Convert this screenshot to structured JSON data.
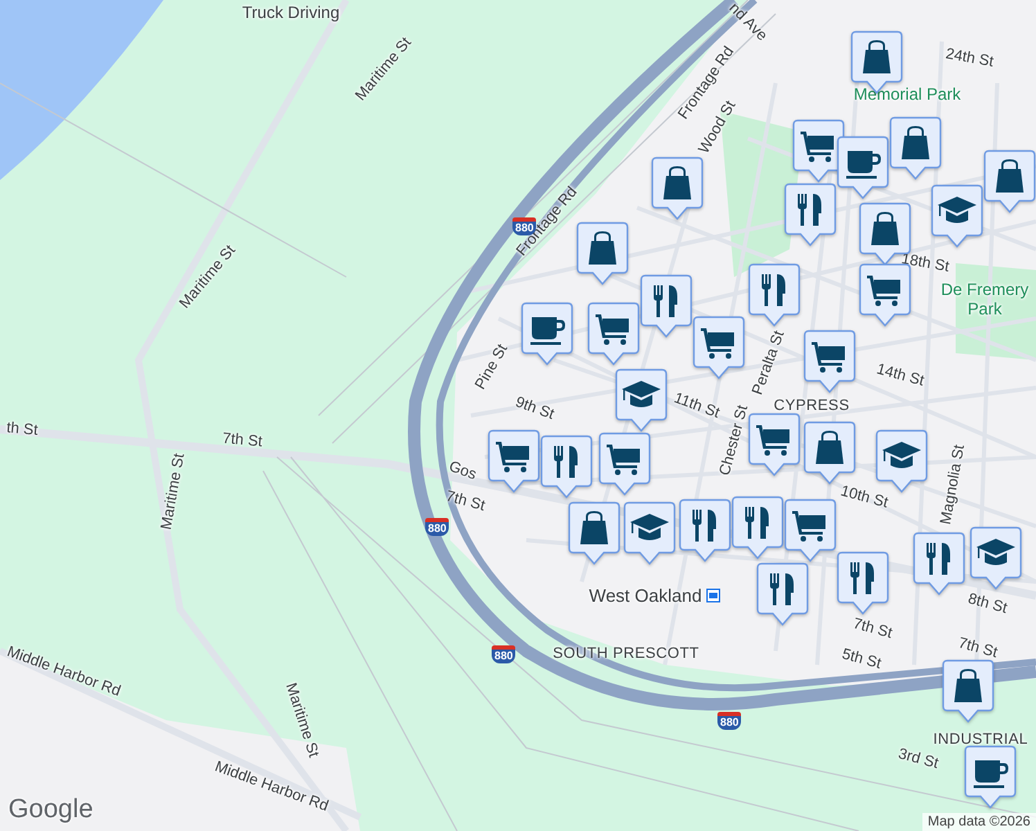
{
  "map": {
    "labels": [
      {
        "text": "Truck Driving",
        "kind": "poi"
      },
      {
        "text": "Maritime St",
        "kind": "street"
      },
      {
        "text": "Maritime St",
        "kind": "street"
      },
      {
        "text": "Maritime St",
        "kind": "street"
      },
      {
        "text": "Maritime St",
        "kind": "street"
      },
      {
        "text": "th St",
        "kind": "street"
      },
      {
        "text": "7th St",
        "kind": "street"
      },
      {
        "text": "7th St",
        "kind": "street"
      },
      {
        "text": "Frontage Rd",
        "kind": "street"
      },
      {
        "text": "Frontage Rd",
        "kind": "street"
      },
      {
        "text": "nd Ave",
        "kind": "street"
      },
      {
        "text": "24th St",
        "kind": "street"
      },
      {
        "text": "Memorial Park",
        "kind": "park"
      },
      {
        "text": "Wood St",
        "kind": "street"
      },
      {
        "text": "18th St",
        "kind": "street"
      },
      {
        "text": "De Fremery",
        "kind": "park"
      },
      {
        "text": "Park",
        "kind": "park"
      },
      {
        "text": "14th St",
        "kind": "street"
      },
      {
        "text": "Peralta St",
        "kind": "street"
      },
      {
        "text": "Pine St",
        "kind": "street"
      },
      {
        "text": "9th St",
        "kind": "street"
      },
      {
        "text": "11th St",
        "kind": "street"
      },
      {
        "text": "CYPRESS",
        "kind": "district"
      },
      {
        "text": "Chester St",
        "kind": "street"
      },
      {
        "text": "10th St",
        "kind": "street"
      },
      {
        "text": "Magnolia St",
        "kind": "street"
      },
      {
        "text": "8th St",
        "kind": "street"
      },
      {
        "text": "West Oakland",
        "kind": "transit"
      },
      {
        "text": "SOUTH PRESCOTT",
        "kind": "district"
      },
      {
        "text": "5th St",
        "kind": "street"
      },
      {
        "text": "7th St",
        "kind": "street"
      },
      {
        "text": "7th St",
        "kind": "street"
      },
      {
        "text": "Middle Harbor Rd",
        "kind": "street"
      },
      {
        "text": "Middle Harbor Rd",
        "kind": "street"
      },
      {
        "text": "INDUSTRIAL",
        "kind": "district"
      },
      {
        "text": "3rd St",
        "kind": "street"
      },
      {
        "text": "Gos",
        "kind": "street"
      }
    ],
    "shields": [
      "880",
      "880",
      "880",
      "880"
    ],
    "pins": [
      {
        "kind": "shopping"
      },
      {
        "kind": "grocery"
      },
      {
        "kind": "cafe"
      },
      {
        "kind": "restaurant"
      },
      {
        "kind": "shopping"
      },
      {
        "kind": "shopping"
      },
      {
        "kind": "shopping"
      },
      {
        "kind": "school"
      },
      {
        "kind": "shopping"
      },
      {
        "kind": "shopping"
      },
      {
        "kind": "restaurant"
      },
      {
        "kind": "restaurant"
      },
      {
        "kind": "grocery"
      },
      {
        "kind": "grocery"
      },
      {
        "kind": "grocery"
      },
      {
        "kind": "grocery"
      },
      {
        "kind": "cafe"
      },
      {
        "kind": "school"
      },
      {
        "kind": "grocery"
      },
      {
        "kind": "shopping"
      },
      {
        "kind": "school"
      },
      {
        "kind": "grocery"
      },
      {
        "kind": "restaurant"
      },
      {
        "kind": "grocery"
      },
      {
        "kind": "shopping"
      },
      {
        "kind": "school"
      },
      {
        "kind": "restaurant"
      },
      {
        "kind": "restaurant"
      },
      {
        "kind": "grocery"
      },
      {
        "kind": "restaurant"
      },
      {
        "kind": "restaurant"
      },
      {
        "kind": "restaurant"
      },
      {
        "kind": "school"
      },
      {
        "kind": "shopping"
      },
      {
        "kind": "cafe"
      }
    ],
    "logo": "Google",
    "attribution": "Map data ©2026"
  }
}
